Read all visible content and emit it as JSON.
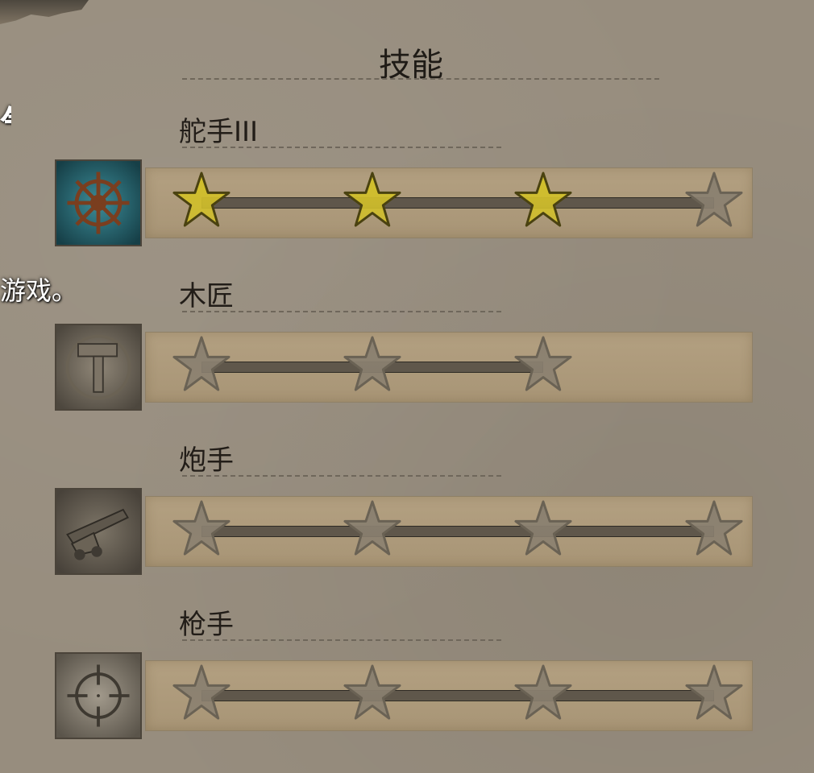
{
  "page": {
    "title": "技能"
  },
  "fragments": {
    "left_char": "气",
    "left_text": "游戏。"
  },
  "skills": [
    {
      "name": "舵手III",
      "icon": "ship-wheel-icon",
      "stars_filled": 3,
      "stars_total": 4
    },
    {
      "name": "木匠",
      "icon": "hammer-icon",
      "stars_filled": 0,
      "stars_total": 3
    },
    {
      "name": "炮手",
      "icon": "cannon-icon",
      "stars_filled": 0,
      "stars_total": 4
    },
    {
      "name": "枪手",
      "icon": "crosshair-icon",
      "stars_filled": 0,
      "stars_total": 4
    }
  ],
  "colors": {
    "star_filled": "#d1bf2a",
    "star_empty": "#8a8070",
    "panel": "#ad9a7b",
    "wheel_bg": "#2d6c78"
  }
}
